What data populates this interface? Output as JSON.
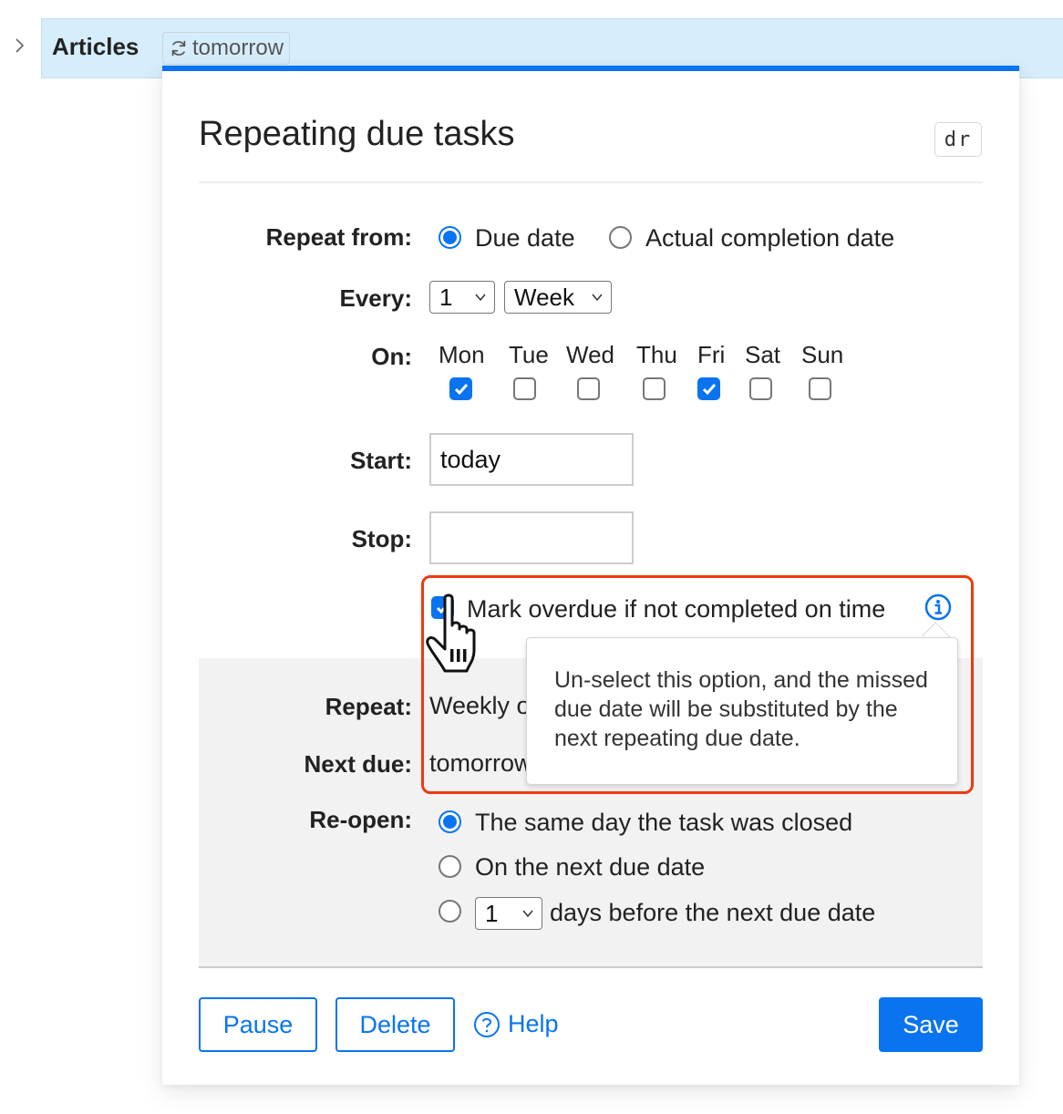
{
  "row": {
    "title": "Articles",
    "due_chip": "tomorrow",
    "expander_icon": "chevron-right-icon",
    "repeat_icon": "repeat-icon"
  },
  "dialog": {
    "title": "Repeating due tasks",
    "shortcut": "dr",
    "repeat_from": {
      "label": "Repeat from:",
      "options": [
        {
          "label": "Due date",
          "selected": true
        },
        {
          "label": "Actual completion date",
          "selected": false
        }
      ]
    },
    "every": {
      "label": "Every:",
      "count": "1",
      "unit": "Week"
    },
    "on": {
      "label": "On:",
      "days": [
        {
          "label": "Mon",
          "checked": true
        },
        {
          "label": "Tue",
          "checked": false
        },
        {
          "label": "Wed",
          "checked": false
        },
        {
          "label": "Thu",
          "checked": false
        },
        {
          "label": "Fri",
          "checked": true
        },
        {
          "label": "Sat",
          "checked": false
        },
        {
          "label": "Sun",
          "checked": false
        }
      ]
    },
    "start": {
      "label": "Start:",
      "value": "today"
    },
    "stop": {
      "label": "Stop:",
      "value": ""
    },
    "mark_overdue": {
      "label": "Mark overdue if not completed on time",
      "checked": true,
      "info_icon": "info-icon"
    },
    "tooltip": "Un-select this option, and the missed due date will be substituted by the next repeating due date.",
    "summary": {
      "repeat_label": "Repeat:",
      "repeat_value": "Weekly o",
      "next_due_label": "Next due:",
      "next_due_value": "tomorrow"
    },
    "reopen": {
      "label": "Re-open:",
      "options": [
        {
          "label": "The same day the task was closed",
          "selected": true
        },
        {
          "label": "On the next due date",
          "selected": false
        },
        {
          "label": "days before the next due date",
          "selected": false,
          "days": "1"
        }
      ]
    },
    "buttons": {
      "pause": "Pause",
      "delete": "Delete",
      "help": "Help",
      "save": "Save"
    }
  },
  "colors": {
    "accent": "#0a74f0",
    "row_highlight": "#d6edfc",
    "annotation_border": "#ee3a10",
    "summary_bg": "#f2f2f2"
  }
}
